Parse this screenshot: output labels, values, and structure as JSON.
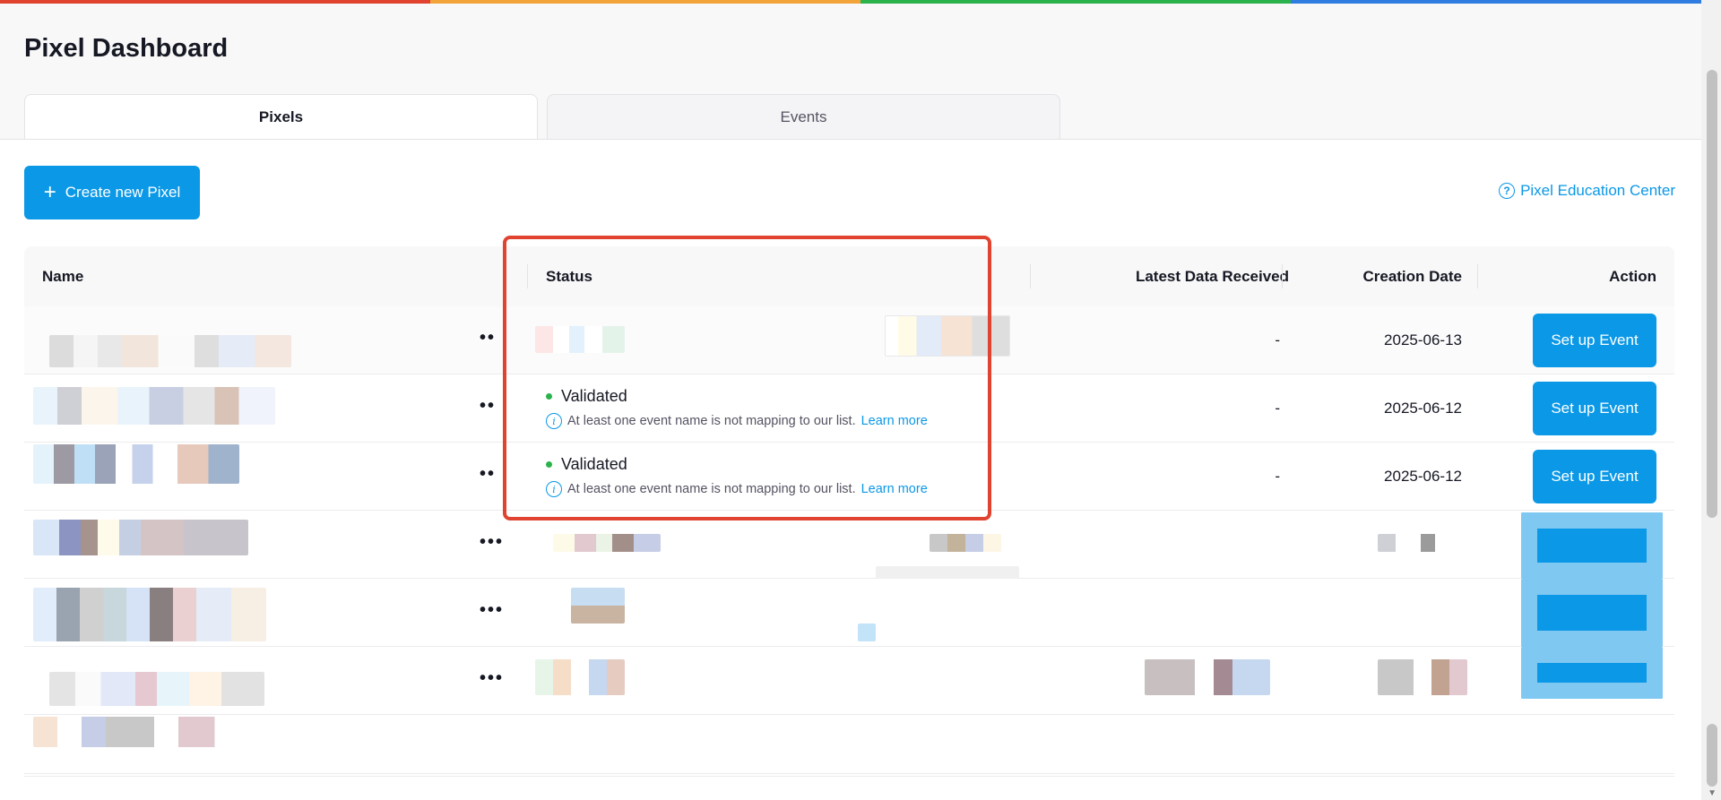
{
  "page_title": "Pixel Dashboard",
  "tabs": [
    {
      "label": "Pixels",
      "active": true
    },
    {
      "label": "Events",
      "active": false
    }
  ],
  "toolbar": {
    "create_label": "Create new Pixel",
    "education_label": "Pixel Education Center"
  },
  "table": {
    "columns": {
      "name": "Name",
      "status": "Status",
      "latest": "Latest Data Received",
      "creation": "Creation Date",
      "action": "Action"
    },
    "rows": [
      {
        "status": "",
        "note": "",
        "learn": "",
        "latest": "-",
        "creation": "2025-06-13",
        "action": "Set up Event"
      },
      {
        "status": "Validated",
        "note": "At least one event name is not mapping to our list.",
        "learn": "Learn more",
        "latest": "-",
        "creation": "2025-06-12",
        "action": "Set up Event"
      },
      {
        "status": "Validated",
        "note": "At least one event name is not mapping to our list.",
        "learn": "Learn more",
        "latest": "-",
        "creation": "2025-06-12",
        "action": "Set up Event"
      }
    ]
  },
  "colors": {
    "accent": "#0b98e6",
    "validated": "#2bb24c",
    "highlight": "#e0432f"
  }
}
